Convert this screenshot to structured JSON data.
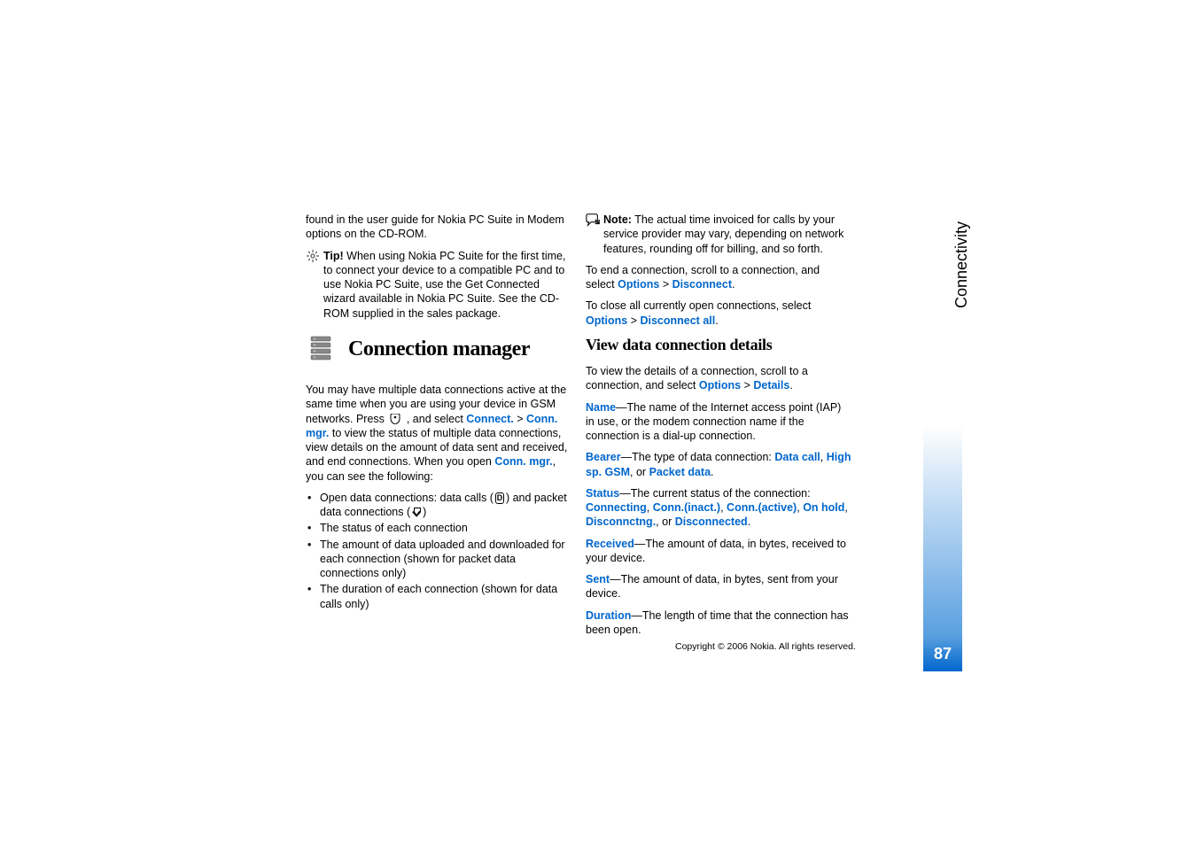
{
  "sidebar_label": "Connectivity",
  "page_number": "87",
  "copyright": "Copyright © 2006 Nokia. All rights reserved.",
  "left": {
    "intro": "found in the user guide for Nokia PC Suite in Modem options on the CD-ROM.",
    "tip_label": "Tip!",
    "tip_body": " When using Nokia PC Suite for the first time, to connect your device to a compatible PC and to use Nokia PC Suite, use the Get Connected wizard available in Nokia PC Suite. See the CD-ROM supplied in the sales package.",
    "section_title": "Connection manager",
    "para1_a": "You may have multiple data connections active at the same time when you are using your device in GSM networks. Press ",
    "para1_b": " , and select ",
    "connect_label": "Connect.",
    "gt": " > ",
    "conn_mgr_label": "Conn. mgr.",
    "para1_c": " to view the status of multiple data connections, view details on the amount of data sent and received, and end connections. When you open ",
    "para1_d": ", you can see the following:",
    "bullet1_a": "Open data connections: data calls (",
    "bullet1_b": ") and packet data connections (",
    "bullet1_c": ")",
    "bullet2": "The status of each connection",
    "bullet3": "The amount of data uploaded and downloaded for each connection (shown for packet data connections only)",
    "bullet4": "The duration of each connection (shown for data calls only)"
  },
  "right": {
    "note_label": "Note:",
    "note_body": " The actual time invoiced for calls by your service provider may vary, depending on network features, rounding off for billing, and so forth.",
    "end_conn_a": "To end a connection, scroll to a connection, and select ",
    "options": "Options",
    "disconnect": "Disconnect",
    "period": ".",
    "close_all_a": "To close all currently open connections, select ",
    "disconnect_all": "Disconnect all",
    "subheading": "View data connection details",
    "view_a": "To view the details of a connection, scroll to a connection, and select ",
    "details": "Details",
    "name_label": "Name",
    "name_body": "—The name of the Internet access point (IAP) in use, or the modem connection name if the connection is a dial-up connection.",
    "bearer_label": "Bearer",
    "bearer_a": "—The type of data connection: ",
    "data_call": "Data call",
    "comma": ", ",
    "high_sp_gsm": "High sp. GSM",
    "or": ", or ",
    "packet_data": "Packet data",
    "status_label": "Status",
    "status_a": "—The current status of the connection: ",
    "connecting": "Connecting",
    "conn_inact": "Conn.(inact.)",
    "conn_active": "Conn.(active)",
    "on_hold": "On hold",
    "disconnctng": "Disconnctng.",
    "disconnected": "Disconnected",
    "received_label": "Received",
    "received_body": "—The amount of data, in bytes, received to your device.",
    "sent_label": "Sent",
    "sent_body": "—The amount of data, in bytes, sent from your device.",
    "duration_label": "Duration",
    "duration_body": "—The length of time that the connection has been open."
  }
}
